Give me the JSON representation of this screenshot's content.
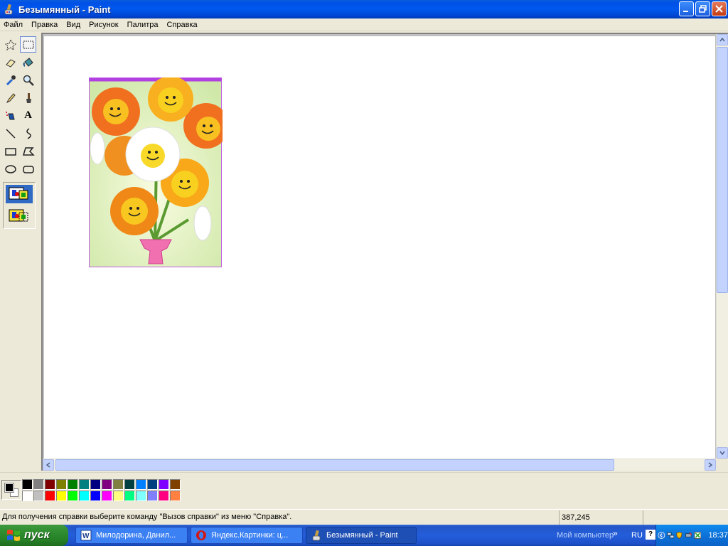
{
  "window": {
    "title": "Безымянный - Paint"
  },
  "menu": [
    "Файл",
    "Правка",
    "Вид",
    "Рисунок",
    "Палитра",
    "Справка"
  ],
  "tools": [
    {
      "name": "free-form-select-tool",
      "icon": "free-form-select-icon"
    },
    {
      "name": "rect-select-tool",
      "icon": "rect-select-icon"
    },
    {
      "name": "eraser-tool",
      "icon": "eraser-icon"
    },
    {
      "name": "fill-tool",
      "icon": "paint-bucket-icon"
    },
    {
      "name": "pick-color-tool",
      "icon": "eyedropper-icon"
    },
    {
      "name": "magnifier-tool",
      "icon": "magnifier-icon"
    },
    {
      "name": "pencil-tool",
      "icon": "pencil-icon"
    },
    {
      "name": "brush-tool",
      "icon": "brush-icon"
    },
    {
      "name": "airbrush-tool",
      "icon": "airbrush-icon"
    },
    {
      "name": "text-tool",
      "icon": "text-a-icon",
      "glyph": "A"
    },
    {
      "name": "line-tool",
      "icon": "line-icon"
    },
    {
      "name": "curve-tool",
      "icon": "curve-icon"
    },
    {
      "name": "rectangle-tool",
      "icon": "rectangle-icon"
    },
    {
      "name": "polygon-tool",
      "icon": "polygon-icon"
    },
    {
      "name": "ellipse-tool",
      "icon": "ellipse-icon"
    },
    {
      "name": "rounded-rect-tool",
      "icon": "rounded-rectangle-icon"
    }
  ],
  "selected_tool": "rect-select-tool",
  "palette": {
    "foreground": "#000000",
    "background": "#ffffff",
    "row1": [
      "#000000",
      "#808080",
      "#800000",
      "#808000",
      "#008000",
      "#008080",
      "#000080",
      "#800080",
      "#808040",
      "#004040",
      "#0080ff",
      "#004080",
      "#8000ff",
      "#804000"
    ],
    "row2": [
      "#ffffff",
      "#c0c0c0",
      "#ff0000",
      "#ffff00",
      "#00ff00",
      "#00ffff",
      "#0000ff",
      "#ff00ff",
      "#ffff80",
      "#00ff80",
      "#80ffff",
      "#8080ff",
      "#ff0080",
      "#ff8040"
    ]
  },
  "status": {
    "help": "Для получения справки выберите команду \"Вызов справки\" из меню \"Справка\".",
    "coords": "387,245"
  },
  "taskbar": {
    "start_label": "пуск",
    "tasks": [
      {
        "label": "Милодорина, Данил...",
        "icon": "word-doc-icon",
        "active": false
      },
      {
        "label": "Яндекс.Картинки: ц...",
        "icon": "opera-browser-icon",
        "active": false
      },
      {
        "label": "Безымянный - Paint",
        "icon": "paint-app-icon",
        "active": true
      }
    ],
    "tray_mycomputer": "Мой компьютер",
    "tray_chevrons": "»",
    "tray_lang": "RU",
    "tray_help": "?",
    "clock": "18:37"
  }
}
